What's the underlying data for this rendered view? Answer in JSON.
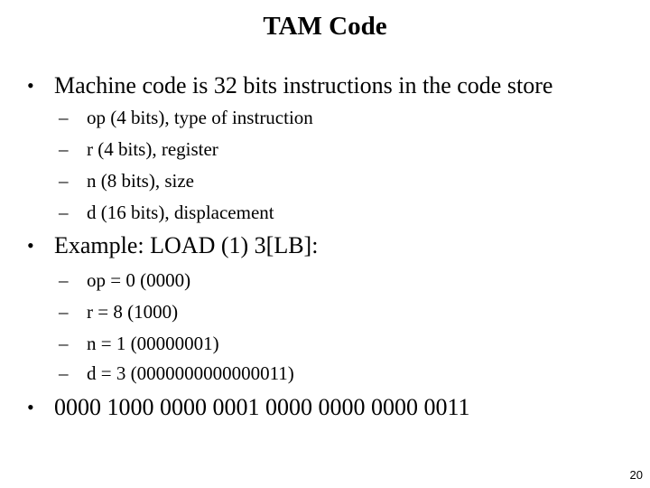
{
  "slide": {
    "title": "TAM Code",
    "bullet_glyph": "•",
    "dash_glyph": "–",
    "bullets": [
      {
        "text": "Machine code is 32 bits instructions in the code store",
        "subitems": [
          "op (4 bits), type of instruction",
          "r (4 bits), register",
          "n (8 bits), size",
          "d (16 bits), displacement"
        ]
      },
      {
        "text": "Example: LOAD (1) 3[LB]:",
        "subitems": [
          "op = 0 (0000)",
          "r = 8 (1000)",
          "n = 1 (00000001)",
          "d = 3 (0000000000000011)"
        ]
      },
      {
        "text": "0000 1000 0000 0001 0000 0000 0000 0011",
        "subitems": []
      }
    ],
    "page_number": "20"
  }
}
